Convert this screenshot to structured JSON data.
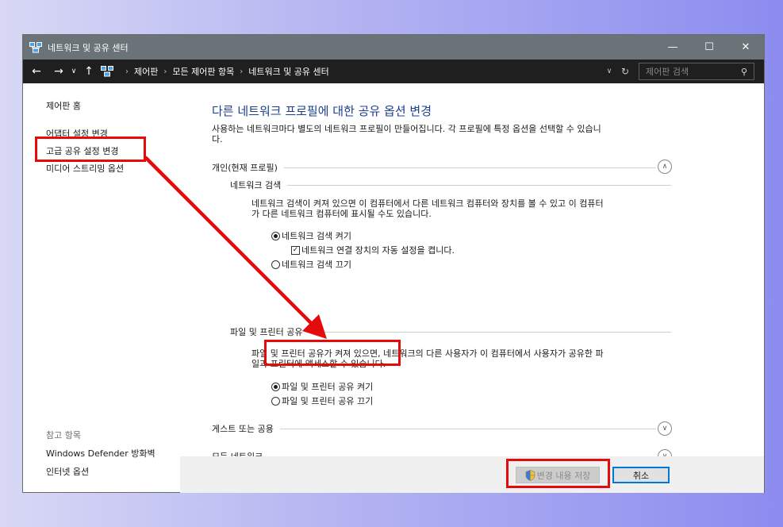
{
  "window": {
    "title": "네트워크 및 공유 센터",
    "controls": {
      "minimize": "—",
      "maximize": "☐",
      "close": "✕"
    }
  },
  "address": {
    "back": "←",
    "forward": "→",
    "recent": "∨",
    "up": "↑",
    "breadcrumbs": [
      "제어판",
      "모든 제어판 항목",
      "네트워크 및 공유 센터"
    ],
    "separator": "›",
    "dropdown": "∨",
    "refresh": "↻",
    "search_placeholder": "제어판 검색",
    "search_icon": "⚲"
  },
  "sidebar": {
    "home": "제어판 홈",
    "links": [
      "어댑터 설정 변경",
      "고급 공유 설정 변경",
      "미디어 스트리밍 옵션"
    ],
    "see_also_title": "참고 항목",
    "see_also": [
      "Windows Defender 방화벽",
      "인터넷 옵션"
    ]
  },
  "main": {
    "title": "다른 네트워크 프로필에 대한 공유 옵션 변경",
    "description_line1": "사용하는 네트워크마다 별도의 네트워크 프로필이 만들어집니다. 각 프로필에 특정 옵션을 선택할 수 있습니",
    "description_line2": "다.",
    "private_profile": {
      "label": "개인(현재 프로필)",
      "chevron": "∧",
      "discovery": {
        "title": "네트워크 검색",
        "desc_line1": "네트워크 검색이 켜져 있으면 이 컴퓨터에서 다른 네트워크 컴퓨터와 장치를 볼 수 있고 이 컴퓨터",
        "desc_line2": "가 다른 네트워크 컴퓨터에 표시될 수도 있습니다.",
        "on_label": "네트워크 검색 켜기",
        "auto_setup_label": "네트워크 연결 장치의 자동 설정을 켭니다.",
        "off_label": "네트워크 검색 끄기",
        "selected": "on",
        "auto_setup_checked": true,
        "check_mark": "✓"
      },
      "file_sharing": {
        "title": "파일 및 프린터 공유",
        "desc_line1": "파일 및 프린터 공유가 켜져 있으면, 네트워크의 다른 사용자가 이 컴퓨터에서 사용자가 공유한 파",
        "desc_line2": "일과 프린터에 액세스할 수 있습니다.",
        "on_label": "파일 및 프린터 공유 켜기",
        "off_label": "파일 및 프린터 공유 끄기",
        "selected": "on"
      }
    },
    "guest_profile": {
      "label": "게스트 또는 공용",
      "chevron": "∨"
    },
    "all_networks": {
      "label": "모든 네트워크",
      "chevron": "∨"
    }
  },
  "footer": {
    "save_label": "변경 내용 저장",
    "cancel_label": "취소"
  },
  "annotation_color": "#e30b0b",
  "colors": {
    "title_bar": "#6a7478",
    "address_bar": "#1f1f1f",
    "heading_blue": "#1c3f8f",
    "focus_blue": "#0078d7"
  }
}
